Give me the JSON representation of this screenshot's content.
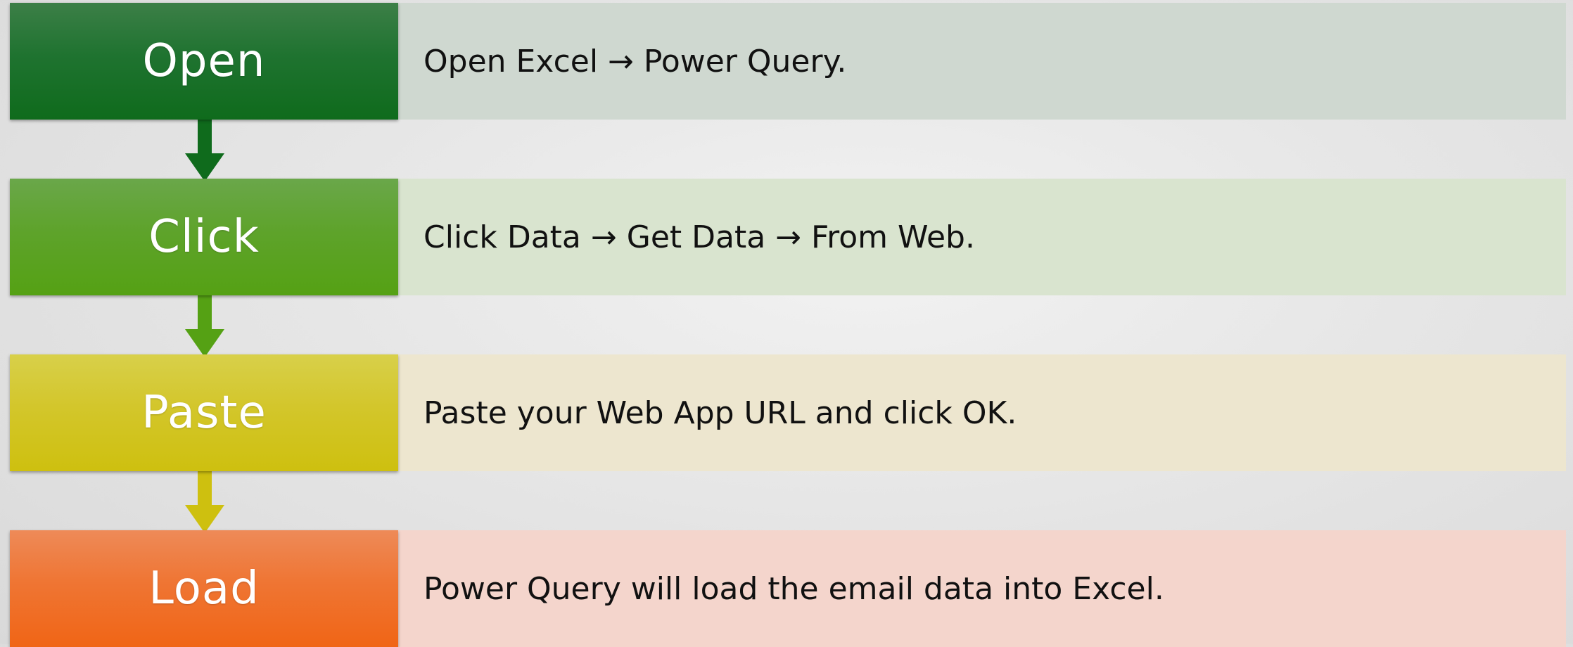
{
  "steps": [
    {
      "label": "Open",
      "description": "Open Excel → Power Query.",
      "color_top": "#3c7f47",
      "color_bottom": "#0f6b1c",
      "desc_bg": "#cfd8d0"
    },
    {
      "label": "Click",
      "description": "Click Data → Get Data → From Web.",
      "color_top": "#6aa74a",
      "color_bottom": "#55a114",
      "desc_bg": "#d9e4cf"
    },
    {
      "label": "Paste",
      "description": "Paste your Web App URL and click OK.",
      "color_top": "#d8d04a",
      "color_bottom": "#cec00f",
      "desc_bg": "#ede6cf"
    },
    {
      "label": "Load",
      "description": "Power Query will load the email data into Excel.",
      "color_top": "#ee8a58",
      "color_bottom": "#f06516",
      "desc_bg": "#f4d5cc"
    }
  ]
}
